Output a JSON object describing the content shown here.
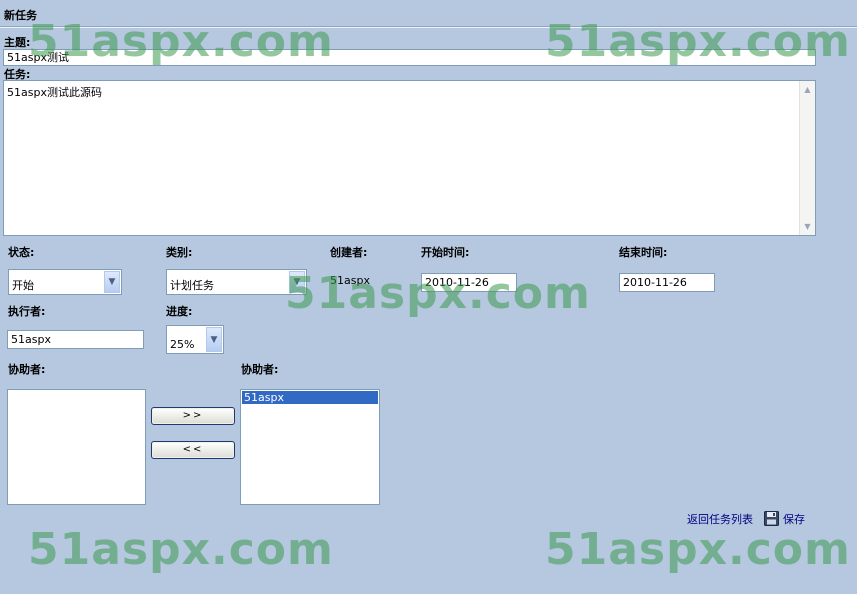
{
  "header": {
    "title": "新任务"
  },
  "subject": {
    "label": "主题:",
    "value": "51aspx测试"
  },
  "task": {
    "label": "任务:",
    "value": "51aspx测试此源码"
  },
  "status": {
    "label": "状态:",
    "selected": "开始"
  },
  "category": {
    "label": "类别:",
    "selected": "计划任务"
  },
  "creator": {
    "label": "创建者:",
    "value": "51aspx"
  },
  "start_time": {
    "label": "开始时间:",
    "value": "2010-11-26"
  },
  "end_time": {
    "label": "结束时间:",
    "value": "2010-11-26"
  },
  "executor": {
    "label": "执行者:",
    "value": "51aspx"
  },
  "progress": {
    "label": "进度:",
    "selected": "25%"
  },
  "assistants_available": {
    "label": "协助者:",
    "items": []
  },
  "assistants_selected": {
    "label": "协助者:",
    "items": [
      "51aspx"
    ]
  },
  "buttons": {
    "add": ">>",
    "remove": "<<"
  },
  "footer": {
    "back_link": "返回任务列表",
    "save_link": "保存"
  },
  "watermark": "51aspx.com",
  "colors": {
    "background": "#b5c8df",
    "accent": "#316ac5",
    "link": "#00007f",
    "watermark": "#3f9a50"
  },
  "icons": {
    "save": "floppy-disk-icon",
    "scroll_up": "arrow-up-icon",
    "scroll_down": "arrow-down-icon",
    "dropdown": "chevron-down-icon"
  }
}
